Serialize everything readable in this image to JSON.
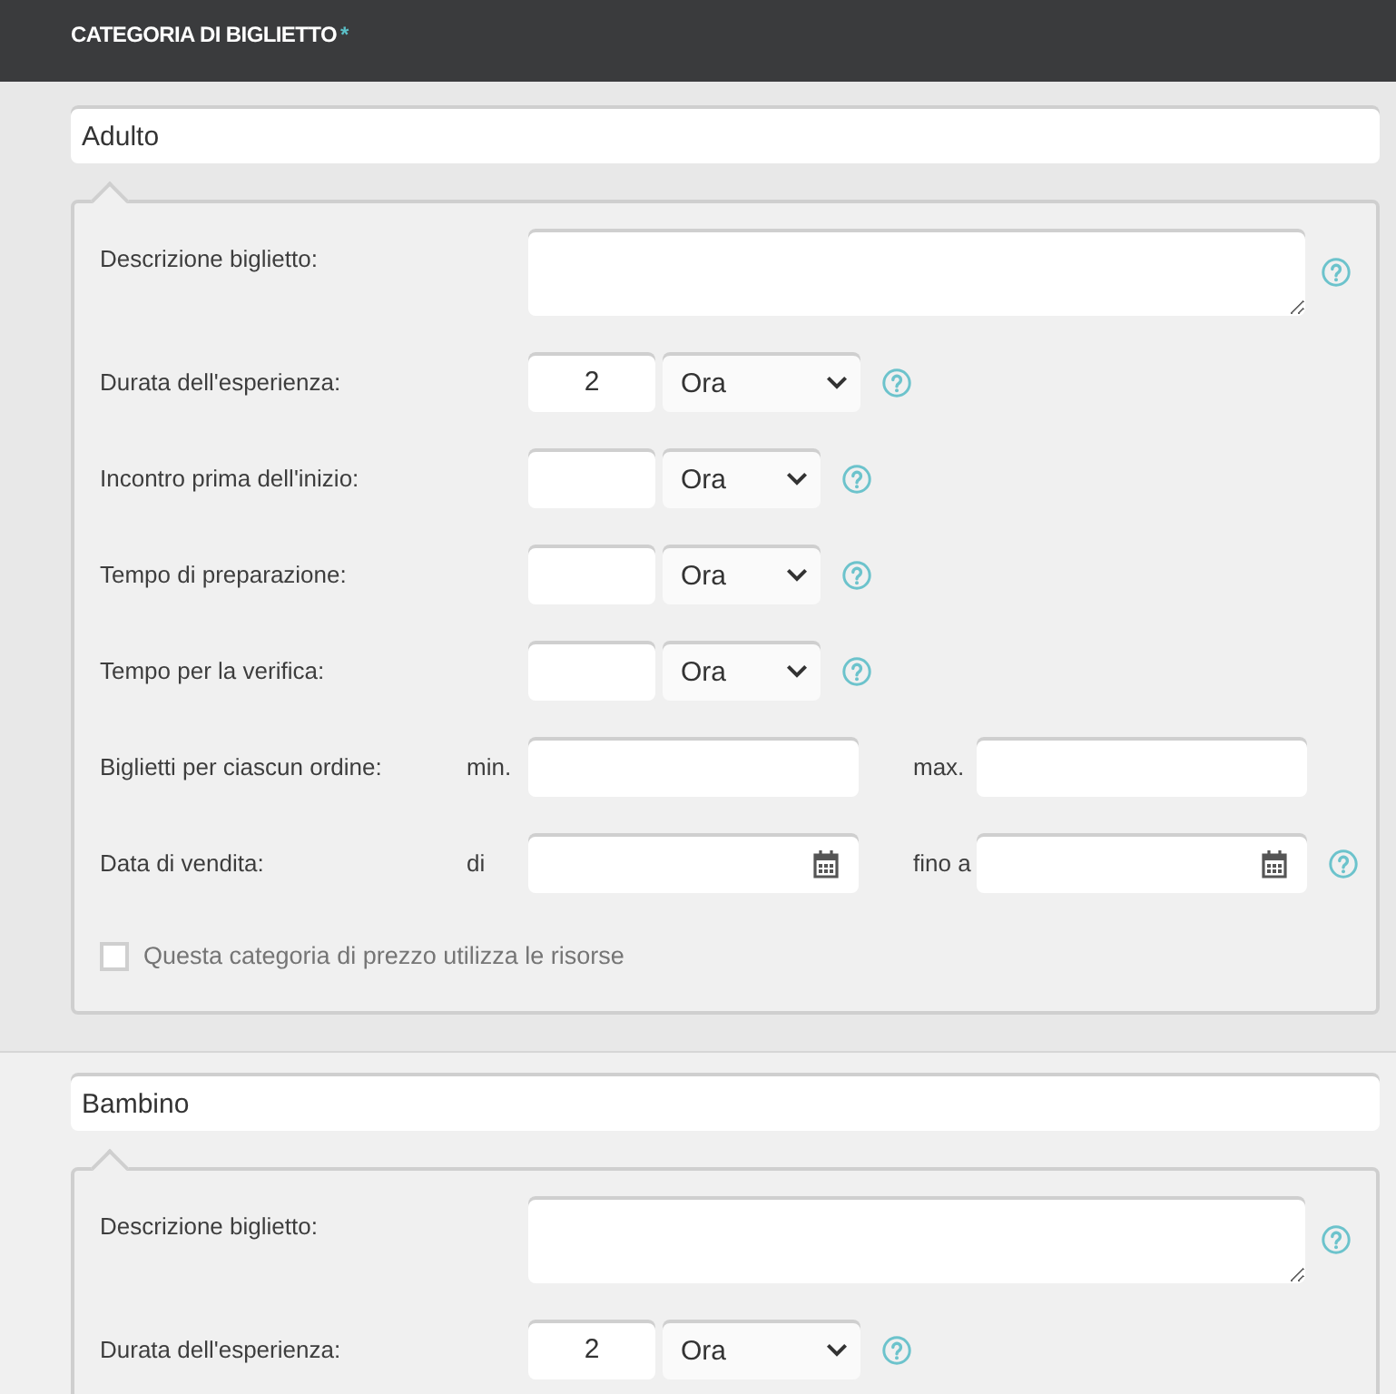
{
  "header": {
    "title": "CATEGORIA DI BIGLIETTO",
    "required_mark": "*"
  },
  "categories": [
    {
      "name": "Adulto",
      "fields": [
        {
          "kind": "textarea",
          "label": "Descrizione biglietto:",
          "help": true
        },
        {
          "kind": "duration",
          "label": "Durata dell'esperienza:",
          "value": "2",
          "unit": "Ora",
          "help": true
        },
        {
          "kind": "duration",
          "label": "Incontro prima dell'inizio:",
          "unit": "Ora",
          "help": true
        },
        {
          "kind": "duration",
          "label": "Tempo di preparazione:",
          "unit": "Ora",
          "help": true
        },
        {
          "kind": "duration",
          "label": "Tempo per la verifica:",
          "unit": "Ora",
          "help": true
        },
        {
          "kind": "range",
          "label": "Biglietti per ciascun ordine:",
          "from_label": "min.",
          "to_label": "max.",
          "help": false
        },
        {
          "kind": "date_range",
          "label": "Data di vendita:",
          "from_label": "di",
          "to_label": "fino a",
          "help": true
        },
        {
          "kind": "checkbox",
          "label": "Questa categoria di prezzo utilizza le risorse",
          "checked": false
        }
      ]
    },
    {
      "name": "Bambino",
      "fields": [
        {
          "kind": "textarea",
          "label": "Descrizione biglietto:",
          "help": true
        },
        {
          "kind": "duration",
          "label": "Durata dell'esperienza:",
          "value": "2",
          "unit": "Ora",
          "help": true
        }
      ]
    }
  ]
}
